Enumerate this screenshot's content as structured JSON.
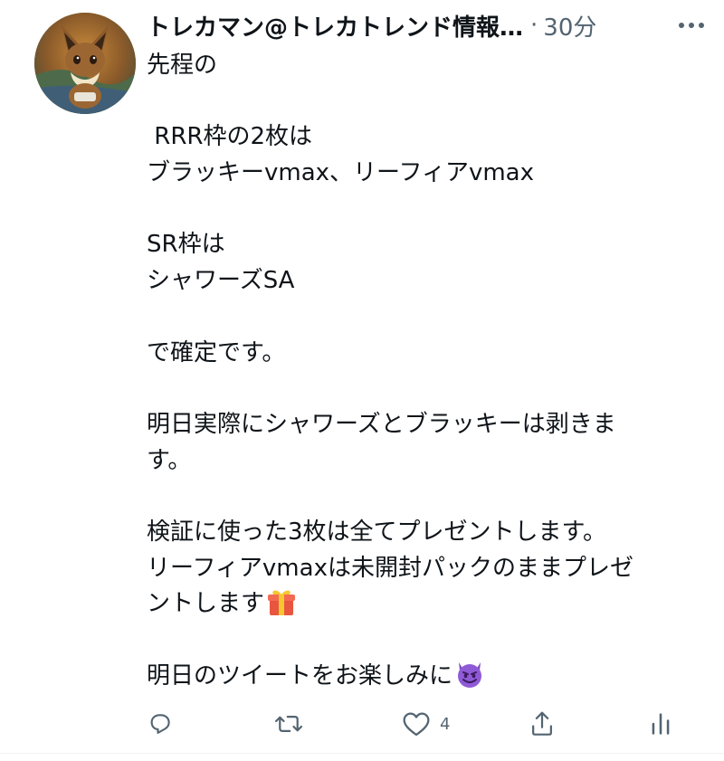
{
  "tweet": {
    "display_name": "トレカマン@トレカトレンド情報…",
    "separator": "·",
    "timestamp": "30分",
    "lines": [
      "先程の",
      "",
      " RRR枠の2枚は",
      "ブラッキーvmax、リーフィアvmax",
      "",
      "SR枠は",
      "シャワーズSA",
      "",
      "で確定です。",
      "",
      "明日実際にシャワーズとブラッキーは剥きま",
      "す。",
      "",
      "検証に使った3枚は全てプレゼントします。",
      "リーフィアvmaxは未開封パックのままプレゼ",
      "ントします",
      "",
      "明日のツイートをお楽しみに"
    ],
    "emojis": {
      "line_16": "gift-emoji",
      "line_18": "smiling-devil-emoji"
    }
  },
  "actions": {
    "reply": {
      "icon": "reply-icon",
      "count": ""
    },
    "retweet": {
      "icon": "retweet-icon",
      "count": ""
    },
    "like": {
      "icon": "heart-icon",
      "count": "4"
    },
    "share": {
      "icon": "share-icon",
      "count": ""
    },
    "analytics": {
      "icon": "analytics-icon",
      "count": ""
    }
  },
  "colors": {
    "text": "#0f1419",
    "secondary": "#536471",
    "divider": "#eff3f4"
  }
}
